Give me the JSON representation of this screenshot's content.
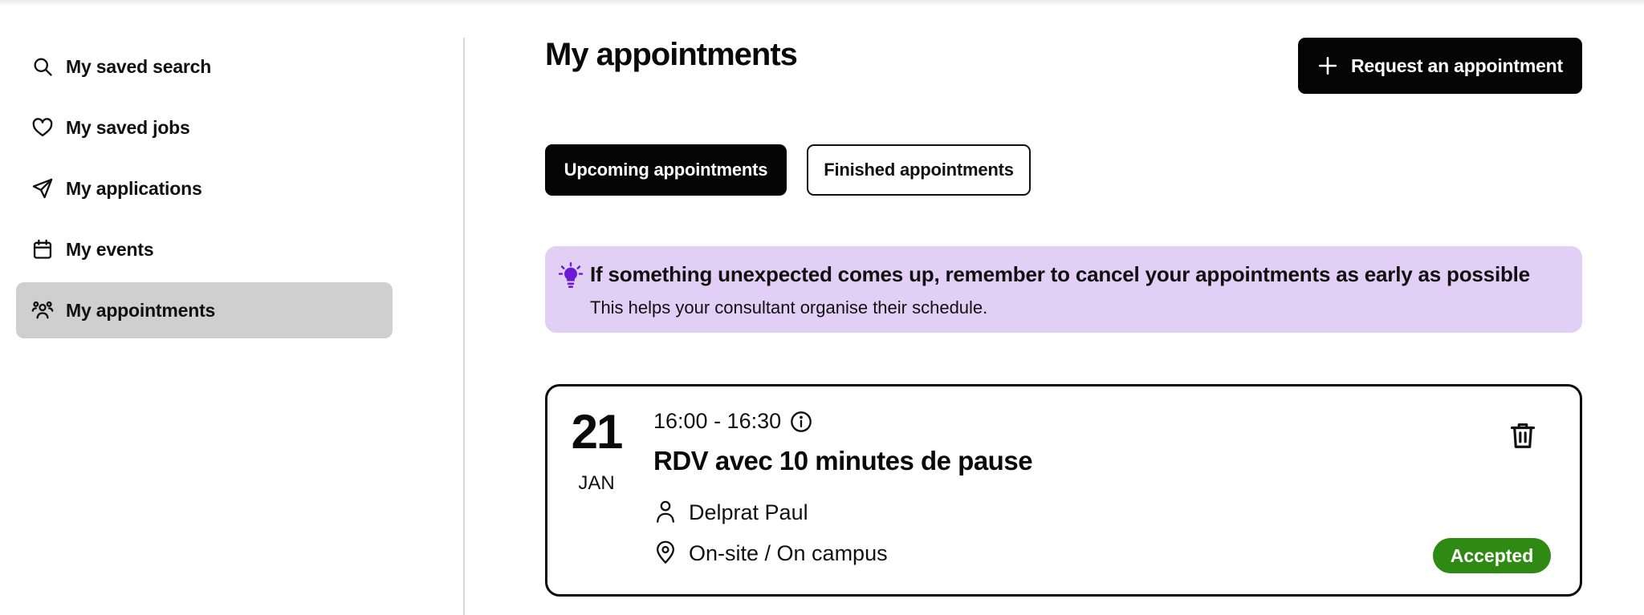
{
  "sidebar": {
    "items": [
      {
        "label": "My saved search",
        "icon": "search-icon"
      },
      {
        "label": "My saved jobs",
        "icon": "heart-icon"
      },
      {
        "label": "My applications",
        "icon": "send-icon"
      },
      {
        "label": "My events",
        "icon": "calendar-icon"
      },
      {
        "label": "My appointments",
        "icon": "people-icon",
        "active": true
      }
    ]
  },
  "main": {
    "title": "My appointments",
    "request_button": {
      "label": "Request an appointment",
      "icon": "plus-icon"
    },
    "tabs": [
      {
        "label": "Upcoming appointments",
        "active": true
      },
      {
        "label": "Finished appointments",
        "active": false
      }
    ],
    "notice": {
      "icon": "lightbulb-icon",
      "title": "If something unexpected comes up, remember to cancel your appointments as early as possible",
      "text": "This helps your consultant organise their schedule."
    },
    "appointments": [
      {
        "day": "21",
        "month": "JAN",
        "time": "16:00 - 16:30",
        "title": "RDV avec 10 minutes de pause",
        "consultant": "Delprat Paul",
        "location": "On-site / On campus",
        "status": "Accepted"
      }
    ]
  },
  "colors": {
    "accent": "#050505",
    "notice_bg": "#e2cff6",
    "notice_icon": "#6b1bd6",
    "status_accepted": "#2e8a12",
    "sidebar_active": "#cfcfcf"
  }
}
